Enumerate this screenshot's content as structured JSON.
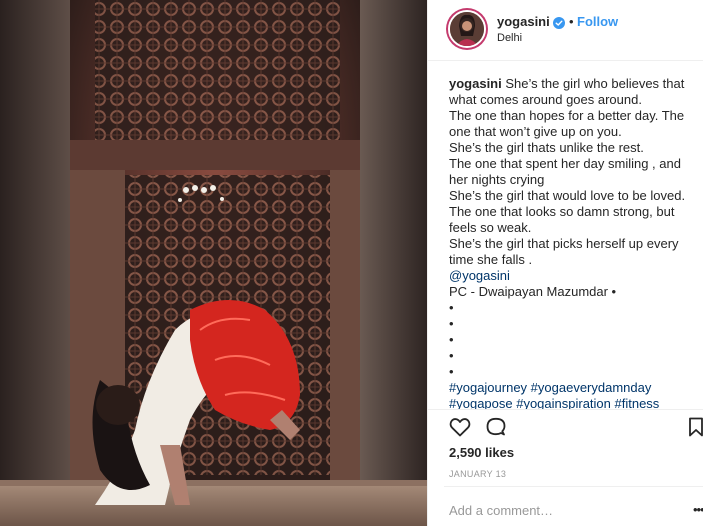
{
  "header": {
    "username": "yogasini",
    "separator": "•",
    "follow_label": "Follow",
    "location": "Delhi"
  },
  "caption": {
    "username": "yogasini",
    "lines": [
      "She’s the girl who believes that what comes around goes around.",
      "The one than hopes for a better day. The one that won’t give up on you.",
      "She’s the girl thats unlike the rest.",
      "The one that spent her day smiling , and her nights crying",
      "She’s the girl that would love to be loved. The one that looks so damn strong, but feels so weak.",
      "She’s the girl that picks herself up every time she falls ."
    ],
    "mention": "@yogasini",
    "credit": "PC - Dwaipayan Mazumdar •",
    "bullets": [
      "•",
      "•",
      "•",
      "•",
      "•"
    ],
    "hashtags_line1": "#yogajourney #yogaeverydamnday",
    "hashtags_line2": "#yogapose #yogainspiration #fitness"
  },
  "stats": {
    "likes": "2,590 likes",
    "date": "JANUARY 13"
  },
  "comment_box": {
    "placeholder": "Add a comment…",
    "more": "•••"
  },
  "icons": {
    "verified": "verified-badge-icon",
    "like": "heart-icon",
    "comment": "comment-icon",
    "save": "bookmark-icon"
  },
  "colors": {
    "accent": "#3897f0",
    "link": "#003569",
    "muted": "#999999",
    "text": "#262626"
  }
}
